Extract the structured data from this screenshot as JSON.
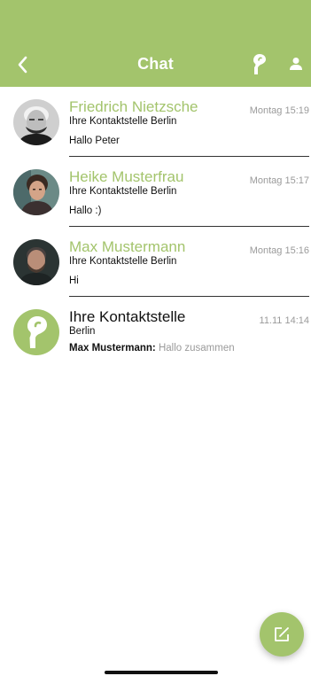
{
  "header": {
    "title": "Chat",
    "back_icon": "chevron-left-icon",
    "logo_icon": "kontaktstelle-logo-icon",
    "profile_icon": "person-icon",
    "color": "#a3c46c"
  },
  "chats": [
    {
      "name": "Friedrich Nietzsche",
      "subtitle": "Ihre Kontaktstelle Berlin",
      "message": "Hallo Peter",
      "time": "Montag 15:19"
    },
    {
      "name": "Heike Musterfrau",
      "subtitle": "Ihre Kontaktstelle Berlin",
      "message": "Hallo :)",
      "time": "Montag 15:17"
    },
    {
      "name": "Max Mustermann",
      "subtitle": "Ihre Kontaktstelle Berlin",
      "message": "Hi",
      "time": "Montag 15:16"
    },
    {
      "name": "Ihre Kontaktstelle",
      "subtitle": "Berlin",
      "sender": "Max Mustermann:",
      "message": "Hallo zusammen",
      "time": "11.11 14:14"
    }
  ],
  "fab": {
    "icon": "compose-icon"
  },
  "colors": {
    "accent": "#a3c46c",
    "muted": "#9a9a9a",
    "text": "#111111"
  }
}
